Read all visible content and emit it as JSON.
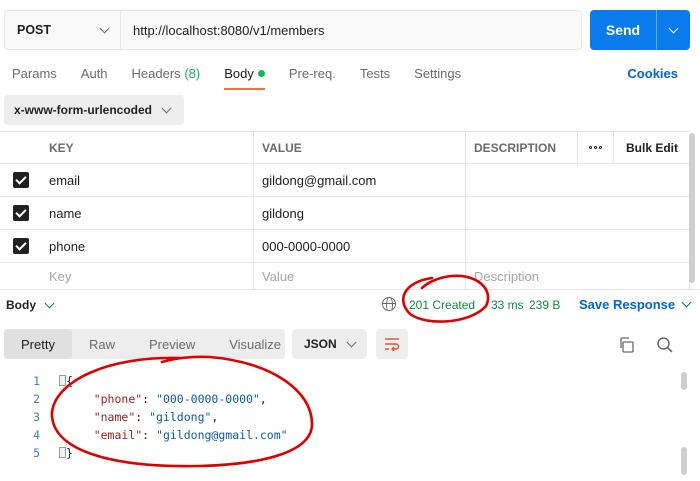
{
  "request": {
    "method": "POST",
    "url": "http://localhost:8080/v1/members",
    "send_label": "Send"
  },
  "tabs": [
    {
      "label": "Params"
    },
    {
      "label": "Auth"
    },
    {
      "label": "Headers",
      "badge": "(8)"
    },
    {
      "label": "Body",
      "active": true
    },
    {
      "label": "Pre-req."
    },
    {
      "label": "Tests"
    },
    {
      "label": "Settings"
    }
  ],
  "cookies_label": "Cookies",
  "body_type": "x-www-form-urlencoded",
  "table": {
    "headers": {
      "key": "KEY",
      "value": "VALUE",
      "description": "DESCRIPTION",
      "bulk_edit": "Bulk Edit"
    },
    "rows": [
      {
        "key": "email",
        "value": "gildong@gmail.com",
        "checked": true
      },
      {
        "key": "name",
        "value": "gildong",
        "checked": true
      },
      {
        "key": "phone",
        "value": "000-0000-0000",
        "checked": true
      }
    ],
    "placeholders": {
      "key": "Key",
      "value": "Value",
      "description": "Description"
    }
  },
  "response": {
    "section_label": "Body",
    "status": "201 Created",
    "time": "33 ms",
    "size": "239 B",
    "save_label": "Save Response",
    "view_tabs": [
      "Pretty",
      "Raw",
      "Preview",
      "Visualize"
    ],
    "active_view": "Pretty",
    "format": "JSON",
    "lines": [
      {
        "n": "1",
        "text": "{"
      },
      {
        "n": "2",
        "key": "\"phone\"",
        "value": "\"000-0000-0000\"",
        "sep": ","
      },
      {
        "n": "3",
        "key": "\"name\"",
        "value": "\"gildong\"",
        "sep": ","
      },
      {
        "n": "4",
        "key": "\"email\"",
        "value": "\"gildong@gmail.com\"",
        "sep": ""
      },
      {
        "n": "5",
        "text": "}"
      }
    ]
  },
  "colors": {
    "accent_orange": "#ff6c37",
    "send_blue": "#097bed",
    "status_green": "#0f8a3c",
    "annotation_red": "#e00000"
  }
}
